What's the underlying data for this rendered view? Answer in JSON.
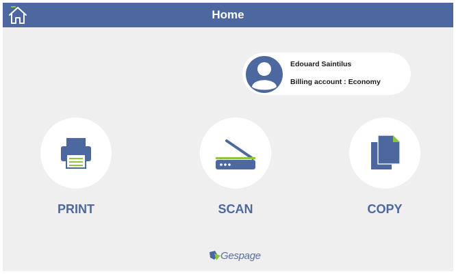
{
  "header": {
    "title": "Home",
    "home_icon": "home-icon"
  },
  "user": {
    "name": "Edouard Saintilus",
    "billing": "Billing account : Economy",
    "avatar_icon": "user-avatar-icon"
  },
  "actions": [
    {
      "label": "PRINT",
      "icon": "printer-icon"
    },
    {
      "label": "SCAN",
      "icon": "scanner-icon"
    },
    {
      "label": "COPY",
      "icon": "copy-icon"
    }
  ],
  "brand": {
    "name": "Gespage"
  },
  "colors": {
    "primary": "#4d689e",
    "background": "#efefef",
    "accent_green": "#8cc63f"
  }
}
